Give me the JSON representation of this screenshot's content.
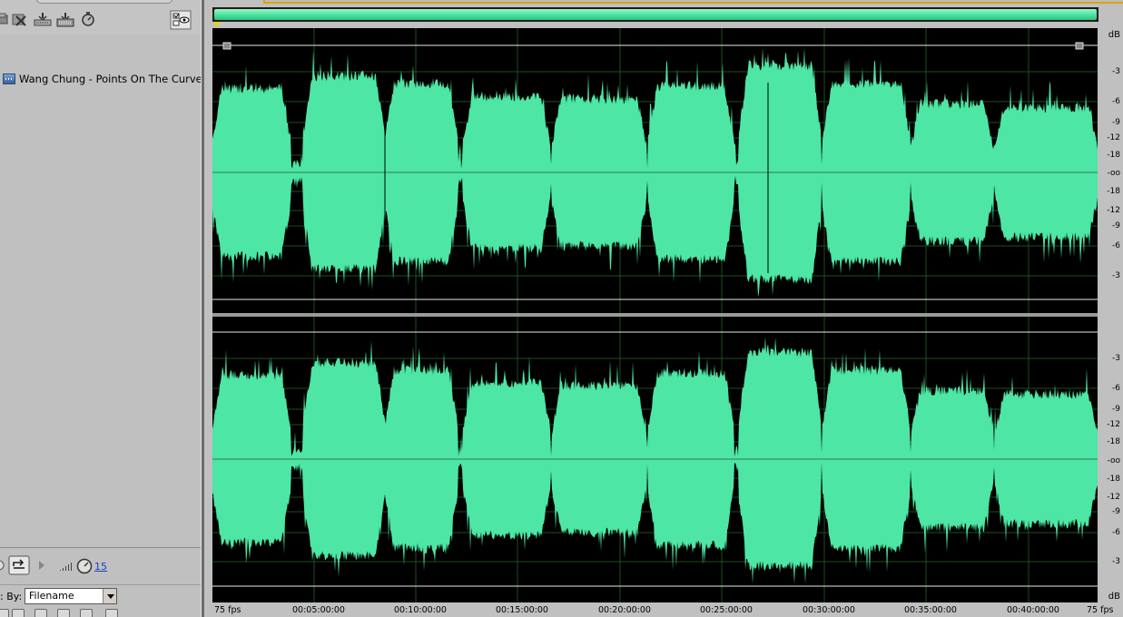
{
  "files_panel": {
    "items": [
      {
        "filename": "Wang Chung - Points On The Curve.wav",
        "icon": "wave-file-icon"
      }
    ],
    "toolbar_icons": [
      "import-icon",
      "close-file-icon",
      "insert-multitrack-icon",
      "insert-cd-icon",
      "autoplay-icon",
      "show-hide-icon"
    ],
    "transport": {
      "icons": [
        "play-icon",
        "loop-icon",
        "next-icon",
        "volume-icon",
        "timer-icon"
      ],
      "autoplay_value": "15"
    },
    "sort": {
      "label": ": By:",
      "selected": "Filename"
    }
  },
  "editor": {
    "waveform_color": "#4de6a4",
    "overview_color": "#4be6a2",
    "grid_color": "#1f4d1f",
    "db_scale_top": [
      "dB",
      "-3",
      "-6",
      "-9",
      "-12",
      "-18",
      "-oo",
      "-18",
      "-12",
      "-9",
      "-6",
      "-3"
    ],
    "db_scale_bottom": [
      "-3",
      "-6",
      "-9",
      "-12",
      "-18",
      "-oo",
      "-18",
      "-12",
      "-9",
      "-6",
      "-3",
      "dB"
    ],
    "time_ruler": {
      "start_label": "75 fps",
      "end_label": "75 fps",
      "ticks": [
        "00:05:00:00",
        "00:10:00:00",
        "00:15:00:00",
        "00:20:00:00",
        "00:25:00:00",
        "00:30:00:00",
        "00:35:00:00",
        "00:40:00:00"
      ]
    }
  }
}
